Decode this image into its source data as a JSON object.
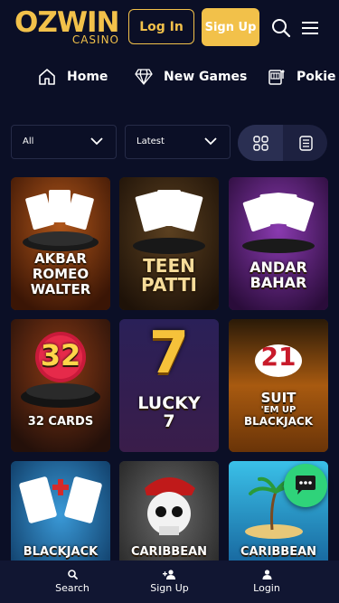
{
  "header": {
    "logo_text": "OZWIN",
    "logo_sub": "CASINO",
    "login_label": "Log In",
    "signup_label": "Sign Up",
    "search_icon": "search-icon",
    "menu_icon": "hamburger-menu-icon"
  },
  "nav": {
    "items": [
      {
        "label": "Home",
        "icon": "home-icon"
      },
      {
        "label": "New Games",
        "icon": "diamond-icon"
      },
      {
        "label": "Pokie",
        "icon": "slot-machine-icon"
      }
    ]
  },
  "filters": {
    "category_value": "All",
    "sort_value": "Latest",
    "view_grid_icon": "grid-view-icon",
    "view_list_icon": "list-view-icon",
    "active_view": "grid"
  },
  "games": [
    {
      "title": "AKBAR ROMEO WALTER",
      "line1": "AKBAR",
      "line2": "ROMEO",
      "line3": "WALTER",
      "bg": "#5a2a0c"
    },
    {
      "title": "TEEN PATTI",
      "line1": "TEEN",
      "line2": "PATTI",
      "line3": "",
      "bg": "#3a2712"
    },
    {
      "title": "ANDAR BAHAR",
      "line1": "ANDAR",
      "line2": "BAHAR",
      "line3": "",
      "bg": "#4a1a5e"
    },
    {
      "title": "32 CARDS",
      "line1": "32",
      "line2": "32 CARDS",
      "line3": "",
      "bg": "#3a1a0e"
    },
    {
      "title": "LUCKY 7",
      "line1": "7",
      "line2": "LUCKY",
      "line3": "7",
      "bg": "#1c1a3a"
    },
    {
      "title": "21 SUIT 'EM UP BLACKJACK",
      "line1": "21",
      "line2": "SUIT",
      "line3": "'EM UP",
      "line4": "BLACKJACK",
      "bg": "#6a3a08"
    },
    {
      "title": "BLACKJACK",
      "line1": "BLACKJACK",
      "bg": "#0e4a78"
    },
    {
      "title": "CARIBBEAN",
      "line1": "CARIBBEAN",
      "bg": "#3a3a3a"
    },
    {
      "title": "CARIBBEAN",
      "line1": "CARIBBEAN",
      "bg": "#1a6fae"
    }
  ],
  "bottom_nav": {
    "items": [
      {
        "label": "Search",
        "icon": "search-icon"
      },
      {
        "label": "Sign Up",
        "icon": "add-user-icon"
      },
      {
        "label": "Login",
        "icon": "user-icon"
      }
    ]
  },
  "chat_icon": "chat-support-icon",
  "colors": {
    "background": "#0b0f26",
    "accent": "#f2c14a",
    "chat": "#2fd37a"
  }
}
